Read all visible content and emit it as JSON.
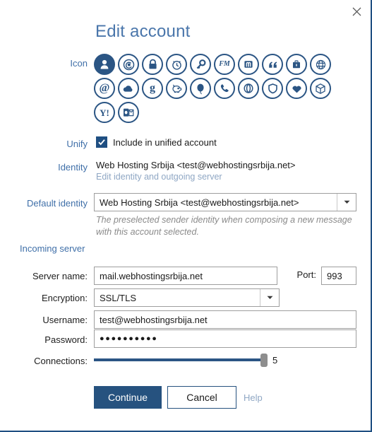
{
  "window": {
    "title": "Edit account",
    "close_icon": "close-icon"
  },
  "labels": {
    "icon": "Icon",
    "unify": "Unify",
    "identity": "Identity",
    "default_identity": "Default identity",
    "incoming_server": "Incoming server",
    "server_name": "Server name:",
    "port": "Port:",
    "encryption": "Encryption:",
    "username": "Username:",
    "password": "Password:",
    "connections": "Connections:"
  },
  "icons": {
    "selected_index": 0,
    "items": [
      {
        "name": "person-icon",
        "selected": true
      },
      {
        "name": "at-swirl-icon",
        "selected": false
      },
      {
        "name": "lock-icon",
        "selected": false
      },
      {
        "name": "alarm-clock-icon",
        "selected": false
      },
      {
        "name": "key-icon",
        "selected": false
      },
      {
        "name": "fastmail-icon",
        "selected": false,
        "text": "FM"
      },
      {
        "name": "mailbox-icon",
        "selected": false,
        "text": "m"
      },
      {
        "name": "quote-icon",
        "selected": false,
        "text": "“"
      },
      {
        "name": "briefcase-icon",
        "selected": false
      },
      {
        "name": "globe-icon",
        "selected": false
      },
      {
        "name": "at-sign-icon",
        "selected": false,
        "text": "@"
      },
      {
        "name": "cloud-icon",
        "selected": false
      },
      {
        "name": "google-icon",
        "selected": false,
        "text": "g"
      },
      {
        "name": "piggy-bank-icon",
        "selected": false
      },
      {
        "name": "balloon-icon",
        "selected": false
      },
      {
        "name": "phone-icon",
        "selected": false
      },
      {
        "name": "opera-icon",
        "selected": false
      },
      {
        "name": "shield-icon",
        "selected": false
      },
      {
        "name": "heart-icon",
        "selected": false
      },
      {
        "name": "box-icon",
        "selected": false
      },
      {
        "name": "yahoo-icon",
        "selected": false,
        "text": "Y!"
      },
      {
        "name": "outlook-icon",
        "selected": false,
        "text": "o"
      }
    ]
  },
  "unify": {
    "checked": true,
    "checkbox_label": "Include in unified account"
  },
  "identity": {
    "value": "Web Hosting Srbija <test@webhostingsrbija.net>",
    "edit_link": "Edit identity and outgoing server"
  },
  "default_identity": {
    "selected": "Web Hosting Srbija <test@webhostingsrbija.net>",
    "hint": "The preselected sender identity when composing a new message with this account selected."
  },
  "incoming_server": {
    "server_name": "mail.webhostingsrbija.net",
    "port": "993",
    "encryption": "SSL/TLS",
    "username": "test@webhostingsrbija.net",
    "password": "●●●●●●●●●●",
    "connections_value": "5"
  },
  "footer": {
    "continue_label": "Continue",
    "cancel_label": "Cancel",
    "help_label": "Help"
  },
  "colors": {
    "accent_dark": "#26527f",
    "accent_label": "#3f6fa8",
    "title": "#4a76ab",
    "link_muted": "#8fa7c4",
    "icon_blue": "#2b5584",
    "border_blue": "#1f4f82"
  }
}
